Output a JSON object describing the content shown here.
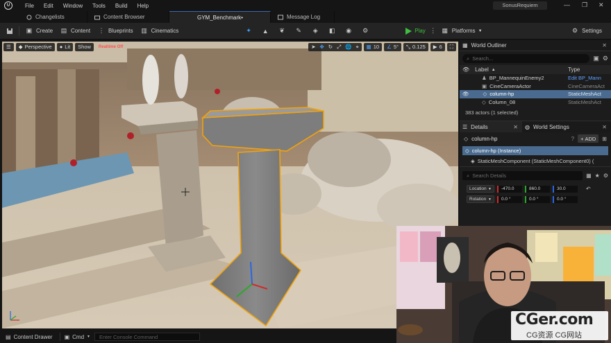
{
  "titlebar": {
    "menu": [
      "File",
      "Edit",
      "Window",
      "Tools",
      "Build",
      "Help"
    ],
    "project_name": "SonusRequiem"
  },
  "tabs": [
    {
      "label": "Changelists",
      "active": false
    },
    {
      "label": "Content Browser",
      "active": false
    },
    {
      "label": "GYM_Benchmark•",
      "active": true
    },
    {
      "label": "Message Log",
      "active": false
    }
  ],
  "toolbar": {
    "create_label": "Create",
    "content_label": "Content",
    "blueprints_label": "Blueprints",
    "cinematics_label": "Cinematics",
    "play_label": "Play",
    "platforms_label": "Platforms",
    "settings_label": "Settings"
  },
  "viewport": {
    "perspective_label": "Perspective",
    "lit_label": "Lit",
    "show_label": "Show",
    "realtime_label": "Realtime Off",
    "grid_snap": "10",
    "rotation_snap": "5°",
    "scale_snap": "0.125",
    "camera_speed": "6"
  },
  "outliner": {
    "title": "World Outliner",
    "search_placeholder": "Search...",
    "col_label": "Label",
    "col_type": "Type",
    "rows": [
      {
        "label": "BP_MannequinEnemy2",
        "type": "Edit BP_Mann"
      },
      {
        "label": "CineCameraActor",
        "type": "CineCameraAct"
      },
      {
        "label": "column-hp",
        "type": "StaticMeshAct"
      },
      {
        "label": "Column_08",
        "type": "StaticMeshAct"
      }
    ],
    "status": "383 actors (1 selected)"
  },
  "details": {
    "title": "Details",
    "world_settings_label": "World Settings",
    "actor_name": "column-hp",
    "add_label": "ADD",
    "instance_label": "column-hp (Instance)",
    "component_label": "StaticMeshComponent (StaticMeshComponent0) (",
    "search_placeholder": "Search Details",
    "location_label": "Location",
    "rotation_label": "Rotation",
    "location": [
      "-470.0",
      "860.0",
      "30.0"
    ],
    "rotation": [
      "0.0 °",
      "0.0 °",
      "0.0 °"
    ]
  },
  "bottombar": {
    "content_drawer_label": "Content Drawer",
    "cmd_label": "Cmd",
    "console_placeholder": "Enter Console Command"
  },
  "watermark": {
    "main": "CGer.com",
    "sub": "CG资源 CG网站"
  },
  "colors": {
    "accent_blue": "#3a6ab0",
    "selection": "#4a6b8f",
    "play_green": "#3fbf3f",
    "outline_orange": "#f2a20c"
  }
}
